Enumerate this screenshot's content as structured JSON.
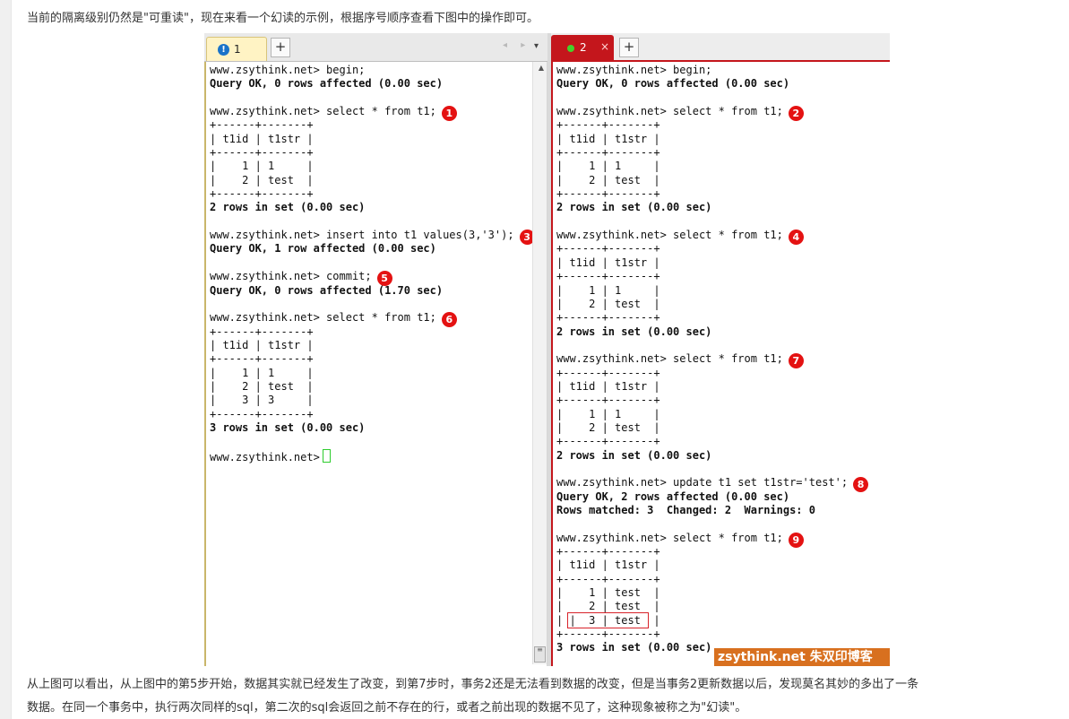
{
  "article": {
    "intro": "当前的隔离级别仍然是\"可重读\"，现在来看一个幻读的示例，根据序号顺序查看下图中的操作即可。",
    "conclusion_line1": "从上图可以看出，从上图中的第5步开始，数据其实就已经发生了改变，到第7步时，事务2还是无法看到数据的改变，但是当事务2更新数据以后，发现莫名其妙的多出了一条",
    "conclusion_line2": "数据。在同一个事务中，执行两次同样的sql，第二次的sql会返回之前不存在的行，或者之前出现的数据不见了，这种现象被称之为\"幻读\"。"
  },
  "screenshot": {
    "left_tab": {
      "badge": "!",
      "label": "1"
    },
    "right_tab": {
      "label": "2",
      "close": "×"
    },
    "plus": "+",
    "nav_arrows": "◂ ▸",
    "tab_menu": "▾",
    "watermark": "zsythink.net 朱双印博客",
    "session1": [
      {
        "t": "www.zsythink.net> begin;"
      },
      {
        "t": "Query OK, 0 rows affected (0.00 sec)",
        "b": true
      },
      {
        "t": ""
      },
      {
        "t": "www.zsythink.net> select * from t1;",
        "step": "1"
      },
      {
        "t": "+------+-------+"
      },
      {
        "t": "| t1id | t1str |"
      },
      {
        "t": "+------+-------+"
      },
      {
        "t": "|    1 | 1     |"
      },
      {
        "t": "|    2 | test  |"
      },
      {
        "t": "+------+-------+"
      },
      {
        "t": "2 rows in set (0.00 sec)",
        "b": true
      },
      {
        "t": ""
      },
      {
        "t": "www.zsythink.net> insert into t1 values(3,'3');",
        "step": "3"
      },
      {
        "t": "Query OK, 1 row affected (0.00 sec)",
        "b": true
      },
      {
        "t": ""
      },
      {
        "t": "www.zsythink.net> commit;",
        "step": "5"
      },
      {
        "t": "Query OK, 0 rows affected (1.70 sec)",
        "b": true
      },
      {
        "t": ""
      },
      {
        "t": "www.zsythink.net> select * from t1;",
        "step": "6"
      },
      {
        "t": "+------+-------+"
      },
      {
        "t": "| t1id | t1str |"
      },
      {
        "t": "+------+-------+"
      },
      {
        "t": "|    1 | 1     |"
      },
      {
        "t": "|    2 | test  |"
      },
      {
        "t": "|    3 | 3     |"
      },
      {
        "t": "+------+-------+"
      },
      {
        "t": "3 rows in set (0.00 sec)",
        "b": true
      },
      {
        "t": ""
      },
      {
        "t": "www.zsythink.net>",
        "cursor": true
      }
    ],
    "session2": [
      {
        "t": "www.zsythink.net> begin;"
      },
      {
        "t": "Query OK, 0 rows affected (0.00 sec)",
        "b": true
      },
      {
        "t": ""
      },
      {
        "t": "www.zsythink.net> select * from t1;",
        "step": "2"
      },
      {
        "t": "+------+-------+"
      },
      {
        "t": "| t1id | t1str |"
      },
      {
        "t": "+------+-------+"
      },
      {
        "t": "|    1 | 1     |"
      },
      {
        "t": "|    2 | test  |"
      },
      {
        "t": "+------+-------+"
      },
      {
        "t": "2 rows in set (0.00 sec)",
        "b": true
      },
      {
        "t": ""
      },
      {
        "t": "www.zsythink.net> select * from t1;",
        "step": "4"
      },
      {
        "t": "+------+-------+"
      },
      {
        "t": "| t1id | t1str |"
      },
      {
        "t": "+------+-------+"
      },
      {
        "t": "|    1 | 1     |"
      },
      {
        "t": "|    2 | test  |"
      },
      {
        "t": "+------+-------+"
      },
      {
        "t": "2 rows in set (0.00 sec)",
        "b": true
      },
      {
        "t": ""
      },
      {
        "t": "www.zsythink.net> select * from t1;",
        "step": "7"
      },
      {
        "t": "+------+-------+"
      },
      {
        "t": "| t1id | t1str |"
      },
      {
        "t": "+------+-------+"
      },
      {
        "t": "|    1 | 1     |"
      },
      {
        "t": "|    2 | test  |"
      },
      {
        "t": "+------+-------+"
      },
      {
        "t": "2 rows in set (0.00 sec)",
        "b": true
      },
      {
        "t": ""
      },
      {
        "t": "www.zsythink.net> update t1 set t1str='test';",
        "step": "8"
      },
      {
        "t": "Query OK, 2 rows affected (0.00 sec)",
        "b": true
      },
      {
        "t": "Rows matched: 3  Changed: 2  Warnings: 0",
        "b": true
      },
      {
        "t": ""
      },
      {
        "t": "www.zsythink.net> select * from t1;",
        "step": "9"
      },
      {
        "t": "+------+-------+"
      },
      {
        "t": "| t1id | t1str |"
      },
      {
        "t": "+------+-------+"
      },
      {
        "t": "|    1 | test  |"
      },
      {
        "t": "|    2 | test  |"
      },
      {
        "t": "|  3 | test ",
        "pre": "| ",
        "post": " |",
        "hl": true
      },
      {
        "t": "+------+-------+"
      },
      {
        "t": "3 rows in set (0.00 sec)",
        "b": true
      }
    ]
  }
}
